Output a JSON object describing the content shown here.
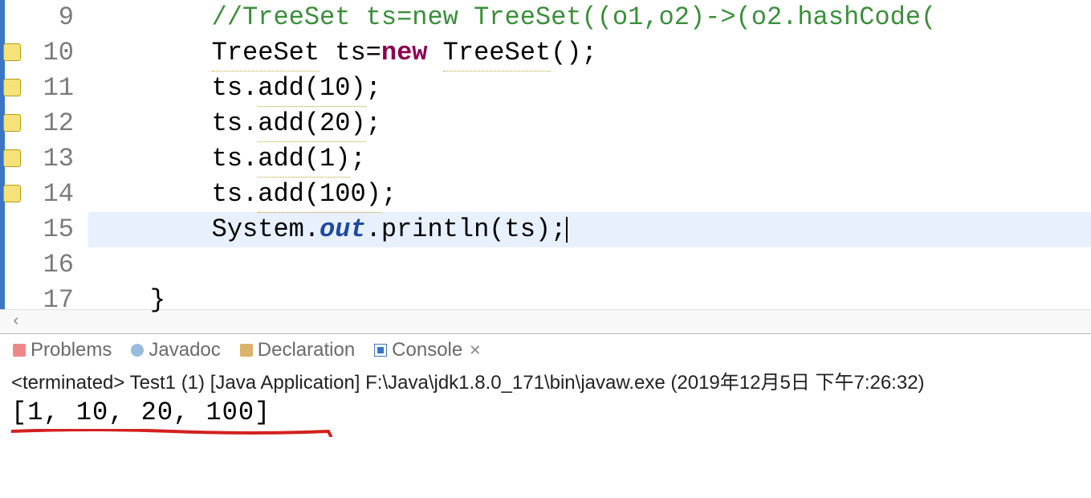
{
  "editor": {
    "lines": [
      {
        "num": "9",
        "warn": false,
        "indent": "        ",
        "tokens": [
          {
            "t": "//TreeSet ts=new TreeSet((o1,o2)->(o2.hashCode(",
            "cls": "tok-comment"
          }
        ]
      },
      {
        "num": "10",
        "warn": true,
        "indent": "        ",
        "tokens": [
          {
            "t": "TreeSet",
            "cls": "tok-default underline"
          },
          {
            "t": " ts=",
            "cls": "tok-default"
          },
          {
            "t": "new",
            "cls": "tok-keyword"
          },
          {
            "t": " ",
            "cls": "tok-default"
          },
          {
            "t": "TreeSet",
            "cls": "tok-default underline"
          },
          {
            "t": "();",
            "cls": "tok-default"
          }
        ]
      },
      {
        "num": "11",
        "warn": true,
        "indent": "        ",
        "tokens": [
          {
            "t": "ts.",
            "cls": "tok-default"
          },
          {
            "t": "add(10)",
            "cls": "tok-default underline"
          },
          {
            "t": ";",
            "cls": "tok-default"
          }
        ]
      },
      {
        "num": "12",
        "warn": true,
        "indent": "        ",
        "tokens": [
          {
            "t": "ts.",
            "cls": "tok-default"
          },
          {
            "t": "add(20)",
            "cls": "tok-default underline"
          },
          {
            "t": ";",
            "cls": "tok-default"
          }
        ]
      },
      {
        "num": "13",
        "warn": true,
        "indent": "        ",
        "tokens": [
          {
            "t": "ts.",
            "cls": "tok-default"
          },
          {
            "t": "add(1)",
            "cls": "tok-default underline"
          },
          {
            "t": ";",
            "cls": "tok-default"
          }
        ]
      },
      {
        "num": "14",
        "warn": true,
        "indent": "        ",
        "tokens": [
          {
            "t": "ts.",
            "cls": "tok-default"
          },
          {
            "t": "add(100)",
            "cls": "tok-default underline"
          },
          {
            "t": ";",
            "cls": "tok-default"
          }
        ]
      },
      {
        "num": "15",
        "warn": false,
        "indent": "        ",
        "hl": true,
        "tokens": [
          {
            "t": "System.",
            "cls": "tok-default"
          },
          {
            "t": "out",
            "cls": "tok-static"
          },
          {
            "t": ".println(ts);",
            "cls": "tok-default"
          }
        ],
        "cursor": true
      },
      {
        "num": "16",
        "warn": false,
        "indent": "",
        "tokens": []
      },
      {
        "num": "17",
        "warn": false,
        "indent": "    ",
        "tokens": [
          {
            "t": "}",
            "cls": "tok-default"
          }
        ]
      }
    ]
  },
  "tabs": {
    "problems": "Problems",
    "javadoc": "Javadoc",
    "declaration": "Declaration",
    "console": "Console"
  },
  "console": {
    "status": "<terminated> Test1 (1) [Java Application] F:\\Java\\jdk1.8.0_171\\bin\\javaw.exe (2019年12月5日 下午7:26:32)",
    "output": "[1, 10, 20, 100]"
  },
  "scroll": {
    "left_arrow": "‹"
  }
}
